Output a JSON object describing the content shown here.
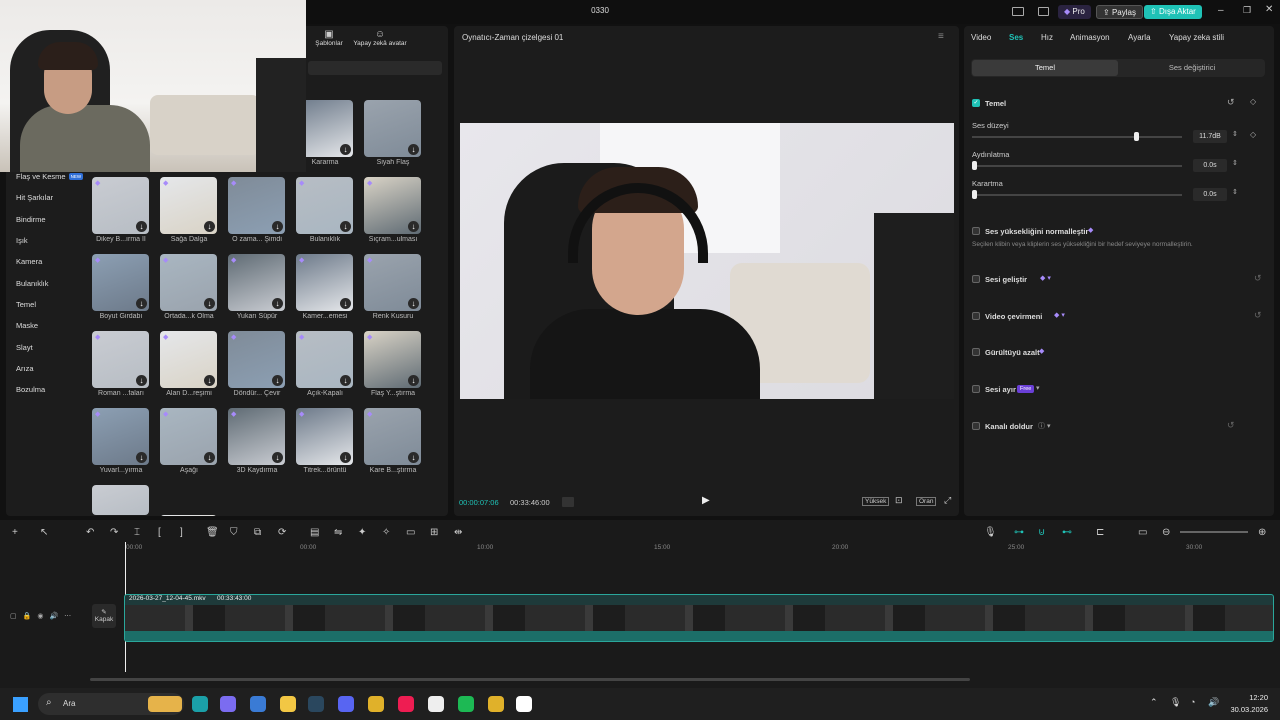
{
  "title_bar": {
    "title": "0330",
    "pro_label": "Pro",
    "share_label": "Paylaş",
    "export_label": "Dışa Aktar"
  },
  "media_tabs": {
    "templates": "Şablonlar",
    "ai_avatar": "Yapay zekâ avatar"
  },
  "categories": [
    "Flaş ve Kesme",
    "Hit Şarkılar",
    "Bindirme",
    "Işık",
    "Kamera",
    "Bulanıklık",
    "Temel",
    "Maske",
    "Slayt",
    "Arıza",
    "Bozulma"
  ],
  "category_badge": "NEW",
  "effects": [
    {
      "label": "Kararma"
    },
    {
      "label": "Siyah Flaş"
    },
    {
      "label": "Dikey B...ırma II"
    },
    {
      "label": "Sağa Dalga"
    },
    {
      "label": "O zama... Şimdi"
    },
    {
      "label": "Bulanıklık"
    },
    {
      "label": "Sıçram...ulması"
    },
    {
      "label": "Boyut Girdabı"
    },
    {
      "label": "Ortada...k Olma"
    },
    {
      "label": "Yukarı Süpür"
    },
    {
      "label": "Kamer...emesi"
    },
    {
      "label": "Renk Kusuru"
    },
    {
      "label": "Roman ...faları"
    },
    {
      "label": "Alan D...reşimi"
    },
    {
      "label": "Döndür... Çevir"
    },
    {
      "label": "Açık-Kapalı"
    },
    {
      "label": "Flaş Y...ştırma"
    },
    {
      "label": "Yuvarl...yırma"
    },
    {
      "label": "Aşağı"
    },
    {
      "label": "3D Kaydırma"
    },
    {
      "label": "Titrek...örüntü"
    },
    {
      "label": "Kare B...ştırma"
    }
  ],
  "player": {
    "title": "Oynatıcı-Zaman çizelgesi 01",
    "current_time": "00:00:07:06",
    "total_time": "00:33:46:00",
    "quality": "Yüksek",
    "ratio": "Oran"
  },
  "inspector": {
    "tabs": [
      "Video",
      "Ses",
      "Hız",
      "Animasyon",
      "Ayarla",
      "Yapay zeka stili"
    ],
    "active_tab": "Ses",
    "subtabs": [
      "Temel",
      "Ses değiştirici"
    ],
    "basic_title": "Temel",
    "volume_label": "Ses düzeyi",
    "volume_value": "11.7dB",
    "volume_level": 0.78,
    "fadein_label": "Aydınlatma",
    "fadein_value": "0.0s",
    "fadeout_label": "Karartma",
    "fadeout_value": "0.0s",
    "normalize_label": "Ses yüksekliğini normalleştir",
    "normalize_desc": "Seçilen klibin veya kliplerin ses yüksekliğini bir hedef seviyeye normalleştirin.",
    "enhance_label": "Sesi geliştir",
    "translate_label": "Video çevirmeni",
    "denoise_label": "Gürültüyü azalt",
    "separate_label": "Sesi ayır",
    "free_badge": "Free",
    "fill_label": "Kanalı doldur"
  },
  "timeline": {
    "ruler": [
      "00:00",
      "00:00",
      "10:00",
      "15:00",
      "20:00",
      "25:00",
      "30:00"
    ],
    "clip_name": "2026-03-27_12-04-45.mkv",
    "clip_duration": "00:33:43:00",
    "cover_label": "Kapak"
  },
  "taskbar": {
    "search": "Ara",
    "time": "12:20",
    "date": "30.03.2026"
  }
}
